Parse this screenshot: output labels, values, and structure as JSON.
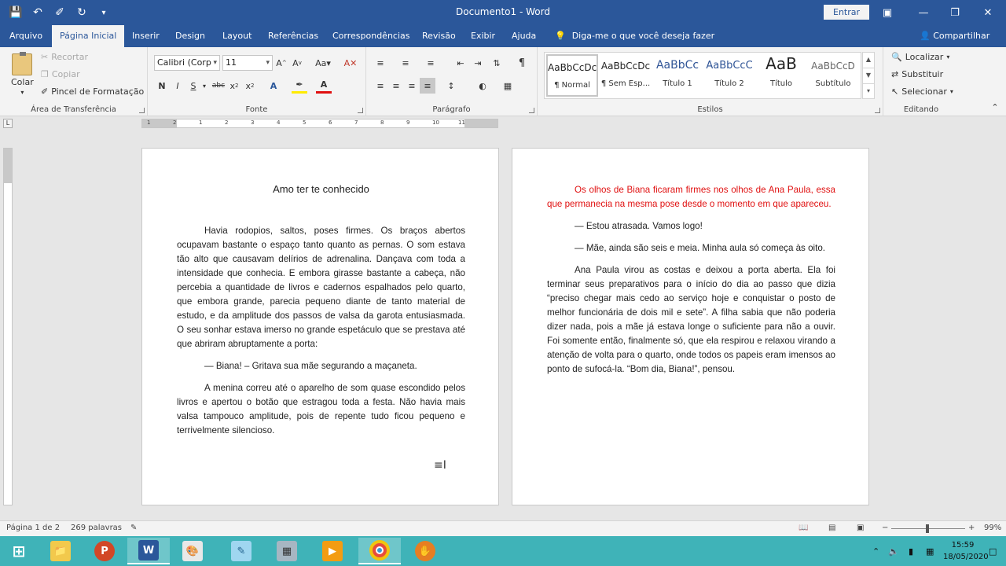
{
  "titlebar": {
    "title": "Documento1 - Word",
    "signin_label": "Entrar",
    "qat_icons": [
      "save-icon",
      "undo-icon",
      "format-painter-icon",
      "redo-icon",
      "customize-icon"
    ]
  },
  "tabs": [
    {
      "label": "Arquivo"
    },
    {
      "label": "Página Inicial"
    },
    {
      "label": "Inserir"
    },
    {
      "label": "Design"
    },
    {
      "label": "Layout"
    },
    {
      "label": "Referências"
    },
    {
      "label": "Correspondências"
    },
    {
      "label": "Revisão"
    },
    {
      "label": "Exibir"
    },
    {
      "label": "Ajuda"
    }
  ],
  "tellme": "Diga-me o que você deseja fazer",
  "share": "Compartilhar",
  "ribbon": {
    "clipboard": {
      "label": "Área de Transferência",
      "paste": "Colar",
      "cut": "Recortar",
      "copy": "Copiar",
      "format_painter": "Pincel de Formatação"
    },
    "font": {
      "label": "Fonte",
      "font_name": "Calibri (Corp",
      "font_size": "11"
    },
    "paragraph": {
      "label": "Parágrafo"
    },
    "styles": {
      "label": "Estilos",
      "items": [
        {
          "sample": "AaBbCcDc",
          "name": "¶ Normal"
        },
        {
          "sample": "AaBbCcDc",
          "name": "¶ Sem Esp..."
        },
        {
          "sample": "AaBbCc",
          "name": "Título 1"
        },
        {
          "sample": "AaBbCcC",
          "name": "Título 2"
        },
        {
          "sample": "AaB",
          "name": "Título"
        },
        {
          "sample": "AaBbCcD",
          "name": "Subtítulo"
        }
      ]
    },
    "editing": {
      "label": "Editando",
      "find": "Localizar",
      "replace": "Substituir",
      "select": "Selecionar"
    }
  },
  "document": {
    "page1": {
      "title": "Amo ter te conhecido",
      "paragraphs": [
        "Havia rodopios, saltos, poses firmes. Os braços abertos ocupavam bastante o espaço tanto quanto as pernas. O som estava tão alto que causavam delírios de adrenalina. Dançava com toda a intensidade que conhecia. E embora girasse bastante a cabeça, não percebia a quantidade de livros e cadernos espalhados pelo quarto, que embora grande, parecia pequeno diante de tanto material de estudo, e da amplitude dos passos de valsa da garota entusiasmada. O seu sonhar estava imerso no grande espetáculo que se prestava até que abriram abruptamente a porta:",
        "— Biana! – Gritava sua mãe segurando a maçaneta.",
        "A menina correu até o aparelho de som quase escondido pelos livros e apertou o botão que estragou toda a festa. Não havia mais valsa tampouco amplitude, pois de repente tudo ficou pequeno e terrivelmente silencioso."
      ]
    },
    "page2": {
      "paragraphs": [
        "Os olhos de Biana ficaram firmes nos olhos de Ana Paula, essa que permanecia na mesma pose desde o momento em que apareceu.",
        "— Estou atrasada. Vamos logo!",
        "— Mãe, ainda são seis e meia. Minha aula só começa às oito.",
        "Ana Paula virou as costas e deixou a porta aberta. Ela foi terminar seus preparativos para o início do dia ao passo que dizia “preciso chegar mais cedo ao serviço hoje e conquistar o posto de melhor funcionária de dois mil e sete”. A filha sabia que não poderia dizer nada, pois a mãe já estava longe o suficiente para não a ouvir. Foi somente então, finalmente só, que ela respirou e relaxou virando a atenção de volta para o quarto, onde todos os papeis eram imensos ao ponto de sufocá-la. “Bom dia, Biana!”, pensou."
      ],
      "red_color": "#e01010"
    }
  },
  "statusbar": {
    "page": "Página 1 de 2",
    "words": "269 palavras",
    "zoom": "99%"
  },
  "taskbar": {
    "time": "15:59",
    "date": "18/05/2020"
  },
  "colors": {
    "word_blue": "#2b579a",
    "taskbar": "#3fb3b8"
  }
}
